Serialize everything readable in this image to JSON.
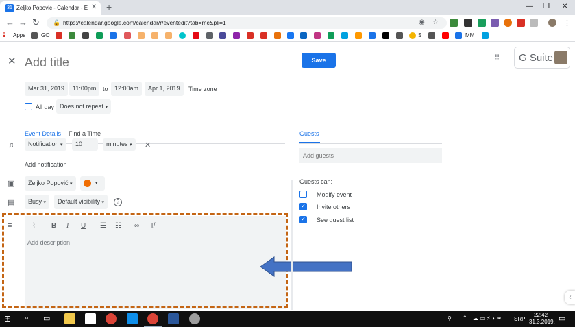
{
  "browser": {
    "tab_title": "Zeljko Popovic - Calendar - Event",
    "tab_favicon": "31",
    "tab_close": "✕",
    "new_tab": "+",
    "window_controls": {
      "minimize": "—",
      "restore": "❐",
      "close": "✕"
    },
    "url": "https://calendar.google.com/calendar/r/eventedit?tab=mc&pli=1",
    "bookmarks": {
      "apps_label": "Apps",
      "go_label": "GO",
      "s_label": "S",
      "mm_label": "MM"
    }
  },
  "event": {
    "title_placeholder": "Add title",
    "save_label": "Save",
    "start_date": "Mar 31, 2019",
    "start_time": "11:00pm",
    "to_label": "to",
    "end_time": "12:00am",
    "end_date": "Apr 1, 2019",
    "time_zone_label": "Time zone",
    "all_day_label": "All day",
    "repeat_value": "Does not repeat",
    "gsuite_label": "G Suite"
  },
  "tabs": {
    "event_details": "Event Details",
    "find_time": "Find a Time"
  },
  "notification": {
    "type": "Notification",
    "amount": "10",
    "unit": "minutes",
    "add_label": "Add notification"
  },
  "calendar_owner": "Željko Popović",
  "event_color": "#ef6c00",
  "availability": "Busy",
  "visibility": "Default visibility",
  "description": {
    "placeholder": "Add description"
  },
  "guests": {
    "tab_label": "Guests",
    "add_placeholder": "Add guests",
    "can_label": "Guests can:",
    "permissions": [
      {
        "label": "Modify event",
        "checked": false
      },
      {
        "label": "Invite others",
        "checked": true
      },
      {
        "label": "See guest list",
        "checked": true
      }
    ]
  },
  "taskbar": {
    "language": "SRP",
    "time": "22:42",
    "date": "31.3.2019."
  },
  "colors": {
    "accent": "#1a73e8",
    "annotation_border": "#c46514",
    "annotation_arrow": "#4472c4"
  }
}
